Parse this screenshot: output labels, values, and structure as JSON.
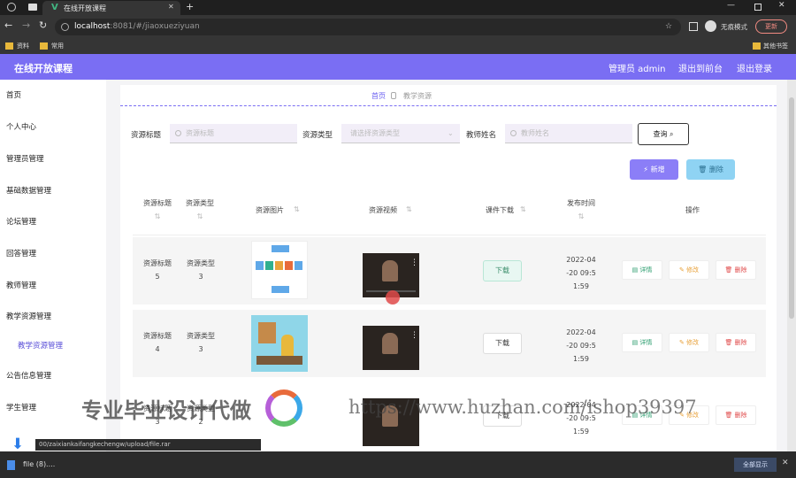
{
  "browser": {
    "tab_title": "在线开放课程",
    "url_host": "localhost",
    "url_rest": ":8081/#/jiaoxueziyuan",
    "bookmarks": [
      "资料",
      "常用"
    ],
    "other_bookmarks": "其他书签",
    "profile_label": "无痕模式",
    "update_label": "更新",
    "download_status_url": "00/zaixiankaifangkechengw/upload/file.rar",
    "download_item": "file (8)....",
    "show_all": "全部显示"
  },
  "app": {
    "title": "在线开放课程",
    "user_label": "管理员 admin",
    "back_label": "退出到前台",
    "logout_label": "退出登录"
  },
  "sidebar": {
    "items": [
      "首页",
      "个人中心",
      "管理员管理",
      "基础数据管理",
      "论坛管理",
      "回答管理",
      "教师管理",
      "教学资源管理",
      "教学资源管理",
      "公告信息管理",
      "学生管理"
    ]
  },
  "breadcrumb": {
    "home": "首页",
    "current": "教学资源"
  },
  "search": {
    "title_label": "资源标题",
    "title_placeholder": "资源标题",
    "type_label": "资源类型",
    "type_placeholder": "请选择资源类型",
    "teacher_label": "教师姓名",
    "teacher_placeholder": "教师姓名",
    "query_button": "查询",
    "add_button": "新增",
    "delete_button": "删除"
  },
  "table": {
    "headers": [
      "资源标题",
      "资源类型",
      "资源图片",
      "资源视频",
      "课件下载",
      "发布时间",
      "操作"
    ],
    "download_label": "下载",
    "ops": [
      "详情",
      "修改",
      "删除"
    ],
    "rows": [
      {
        "title": "资源标题\n5",
        "type": "资源类型\n3",
        "time": "2022-04\n-20 09:5\n1:59"
      },
      {
        "title": "资源标题\n4",
        "type": "资源类型\n3",
        "time": "2022-04\n-20 09:5\n1:59"
      },
      {
        "title": "资源标题\n3",
        "type": "资源类型\n2",
        "time": "2022-04\n-20 09:5\n1:59"
      }
    ]
  },
  "watermark": {
    "left": "专业毕业设计代做",
    "right": "https://www.huzhan.com/ishop39397"
  },
  "colors": {
    "header": "#7a6ef3",
    "add_button": "#8b7ef7",
    "delete_button": "#8fd3f3",
    "download_button_active": "#e8f7f2"
  }
}
